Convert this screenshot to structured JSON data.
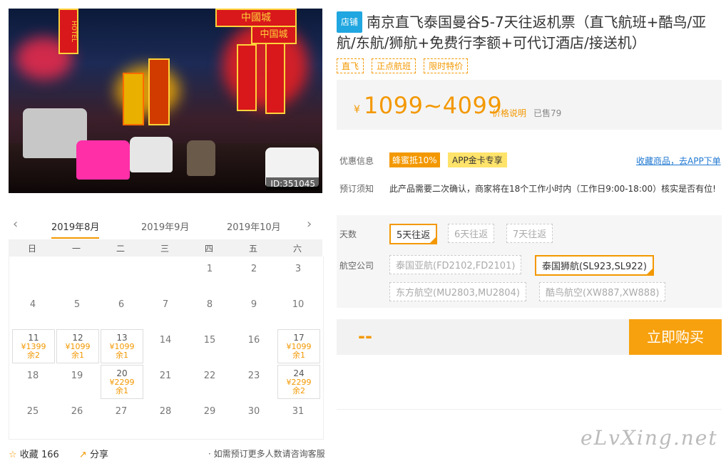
{
  "hero": {
    "id_label": "ID:351045",
    "sign_texts": [
      "中國城",
      "中国城",
      "HOTEL"
    ]
  },
  "calendar": {
    "months": [
      "2019年8月",
      "2019年9月",
      "2019年10月"
    ],
    "weekdays": [
      "日",
      "一",
      "二",
      "三",
      "四",
      "五",
      "六"
    ],
    "days": [
      {
        "n": "1"
      },
      {
        "n": "2"
      },
      {
        "n": "3"
      },
      {
        "n": "4"
      },
      {
        "n": "5"
      },
      {
        "n": "6"
      },
      {
        "n": "7"
      },
      {
        "n": "8"
      },
      {
        "n": "9"
      },
      {
        "n": "10"
      },
      {
        "n": "11",
        "p": "¥1399",
        "s": "余2"
      },
      {
        "n": "12",
        "p": "¥1099",
        "s": "余1"
      },
      {
        "n": "13",
        "p": "¥1099",
        "s": "余1"
      },
      {
        "n": "14"
      },
      {
        "n": "15"
      },
      {
        "n": "16"
      },
      {
        "n": "17",
        "p": "¥1099",
        "s": "余1"
      },
      {
        "n": "18"
      },
      {
        "n": "19"
      },
      {
        "n": "20",
        "p": "¥2299",
        "s": "余1"
      },
      {
        "n": "21"
      },
      {
        "n": "22"
      },
      {
        "n": "23"
      },
      {
        "n": "24",
        "p": "¥2299",
        "s": "余2"
      },
      {
        "n": "25"
      },
      {
        "n": "26"
      },
      {
        "n": "27"
      },
      {
        "n": "28"
      },
      {
        "n": "29"
      },
      {
        "n": "30"
      },
      {
        "n": "31"
      }
    ]
  },
  "footer": {
    "fav": "收藏",
    "fav_count": "166",
    "share": "分享",
    "note": "· 如需预订更多人数请咨询客服"
  },
  "product": {
    "shop_badge": "店铺",
    "title": "南京直飞泰国曼谷5-7天往返机票（直飞航班+酷鸟/亚航/东航/狮航+免费行李额+可代订酒店/接送机）",
    "tags": [
      "直飞",
      "正点航班",
      "限时特价"
    ],
    "price_symbol": "¥",
    "price": "1099~4099",
    "price_explain": "价格说明",
    "sold": "已售79"
  },
  "info": {
    "discount_label": "优惠信息",
    "badge1": "蜂蜜抵10%",
    "badge2": "APP金卡专享",
    "fav_link": "收藏商品，去APP下单",
    "notice_label": "预订须知",
    "notice_text": "此产品需要二次确认，商家将在18个工作小时内（工作日9:00-18:00）核实是否有位!"
  },
  "options": {
    "days_label": "天数",
    "days": [
      "5天往返",
      "6天往返",
      "7天往返"
    ],
    "airline_label": "航空公司",
    "airlines": [
      "泰国亚航(FD2102,FD2101)",
      "泰国狮航(SL923,SL922)",
      "东方航空(MU2803,MU2804)",
      "酷鸟航空(XW887,XW888)"
    ]
  },
  "buy": {
    "dash": "--",
    "button": "立即购买"
  },
  "watermark": "eLvXing.net"
}
